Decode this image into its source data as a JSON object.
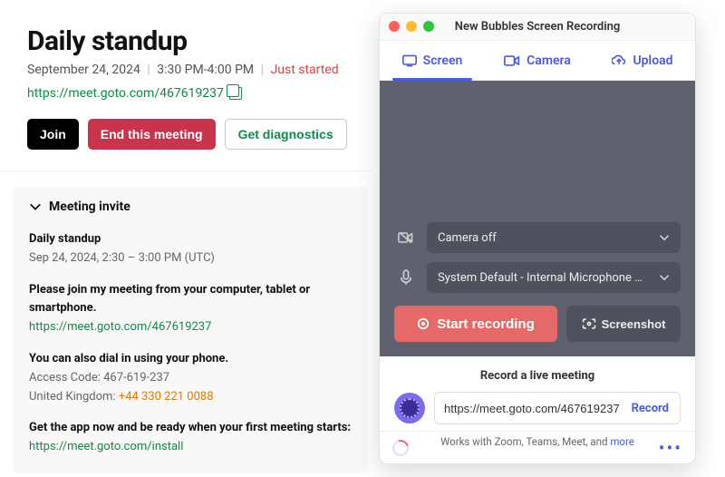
{
  "meeting": {
    "title": "Daily standup",
    "date": "September 24, 2024",
    "time": "3:30 PM-4:00 PM",
    "status": "Just started",
    "url": "https://meet.goto.com/467619237",
    "buttons": {
      "join": "Join",
      "end": "End this meeting",
      "diag": "Get diagnostics"
    }
  },
  "invite": {
    "header": "Meeting invite",
    "title": "Daily standup",
    "subtitle": "Sep 24, 2024, 2:30 – 3:00 PM (UTC)",
    "join_line": "Please join my meeting from your computer, tablet or smartphone.",
    "join_url": "https://meet.goto.com/467619237",
    "dial_line": "You can also dial in using your phone.",
    "access_label": "Access Code:",
    "access_code": "467-619-237",
    "country_label": "United Kingdom:",
    "phone": "+44 330 221 0088",
    "install_line": "Get the app now and be ready when your first meeting starts:",
    "install_url": "https://meet.goto.com/install"
  },
  "recorder": {
    "window_title": "New Bubbles Screen Recording",
    "tabs": {
      "screen": "Screen",
      "camera": "Camera",
      "upload": "Upload"
    },
    "camera_select": "Camera off",
    "mic_select": "System Default - Internal Microphone (Bui…",
    "start": "Start recording",
    "screenshot": "Screenshot",
    "live_title": "Record a live meeting",
    "live_url": "https://meet.goto.com/467619237",
    "record_btn": "Record",
    "works_prefix": "Works with Zoom, Teams, Meet, and ",
    "works_more": "more"
  }
}
